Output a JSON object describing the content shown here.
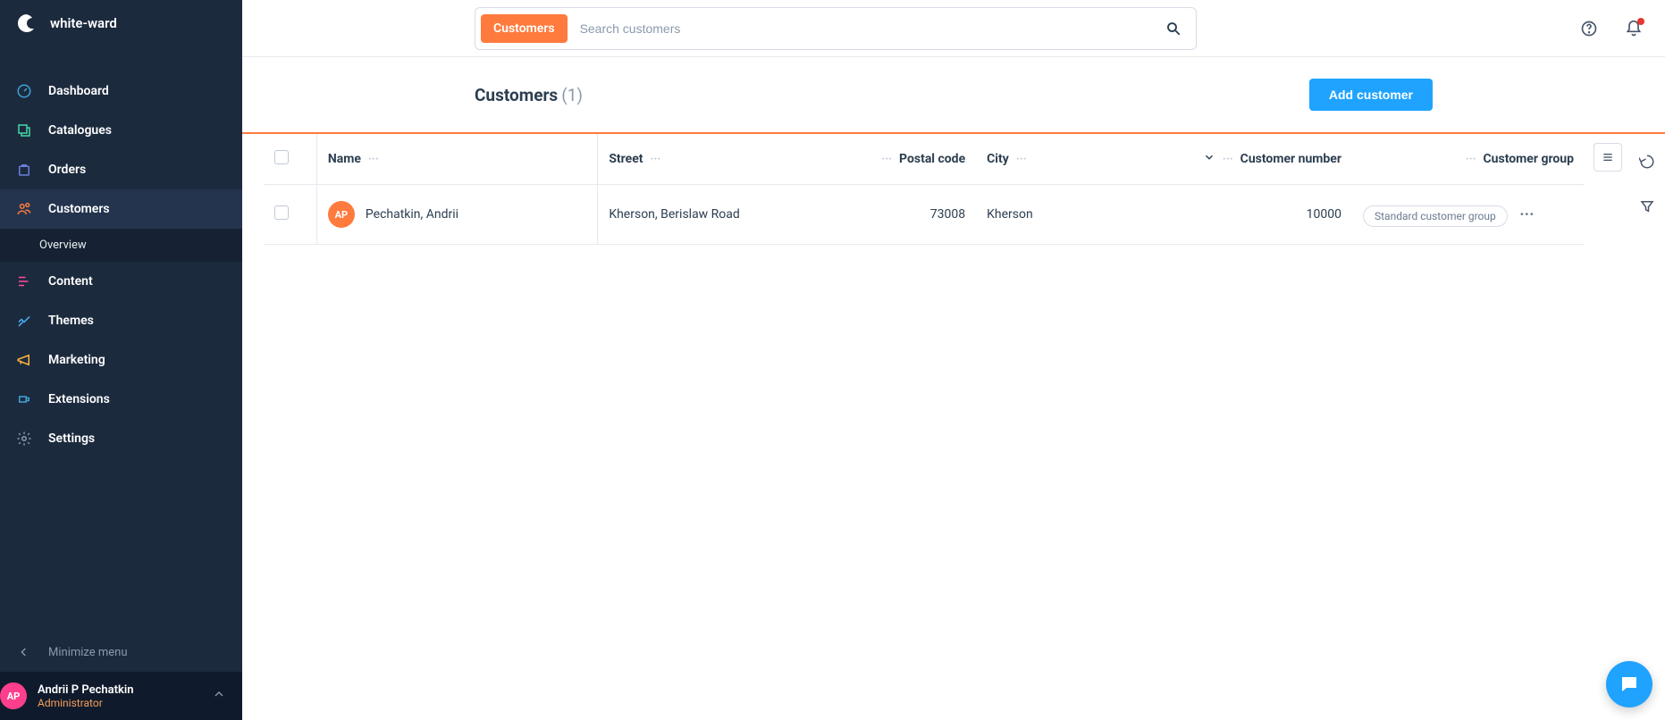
{
  "brand": {
    "name": "white-ward"
  },
  "nav": {
    "dashboard": "Dashboard",
    "catalogues": "Catalogues",
    "orders": "Orders",
    "customers": "Customers",
    "customers_overview": "Overview",
    "content": "Content",
    "themes": "Themes",
    "marketing": "Marketing",
    "extensions": "Extensions",
    "settings": "Settings",
    "minimize": "Minimize menu"
  },
  "user": {
    "initials": "AP",
    "name": "Andrii P Pechatkin",
    "role": "Administrator"
  },
  "search": {
    "tag": "Customers",
    "placeholder": "Search customers"
  },
  "page": {
    "title": "Customers",
    "count": "(1)",
    "add_button": "Add customer"
  },
  "columns": {
    "name": "Name",
    "street": "Street",
    "postal": "Postal code",
    "city": "City",
    "number": "Customer number",
    "group": "Customer group"
  },
  "rows": [
    {
      "initials": "AP",
      "name": "Pechatkin, Andrii",
      "street": "Kherson, Berislaw Road",
      "postal": "73008",
      "city": "Kherson",
      "number": "10000",
      "group": "Standard customer group"
    }
  ],
  "colors": {
    "accent_orange": "#ff7a3d",
    "accent_blue": "#1fa3ff",
    "sidebar_bg": "#1c2a3e"
  }
}
